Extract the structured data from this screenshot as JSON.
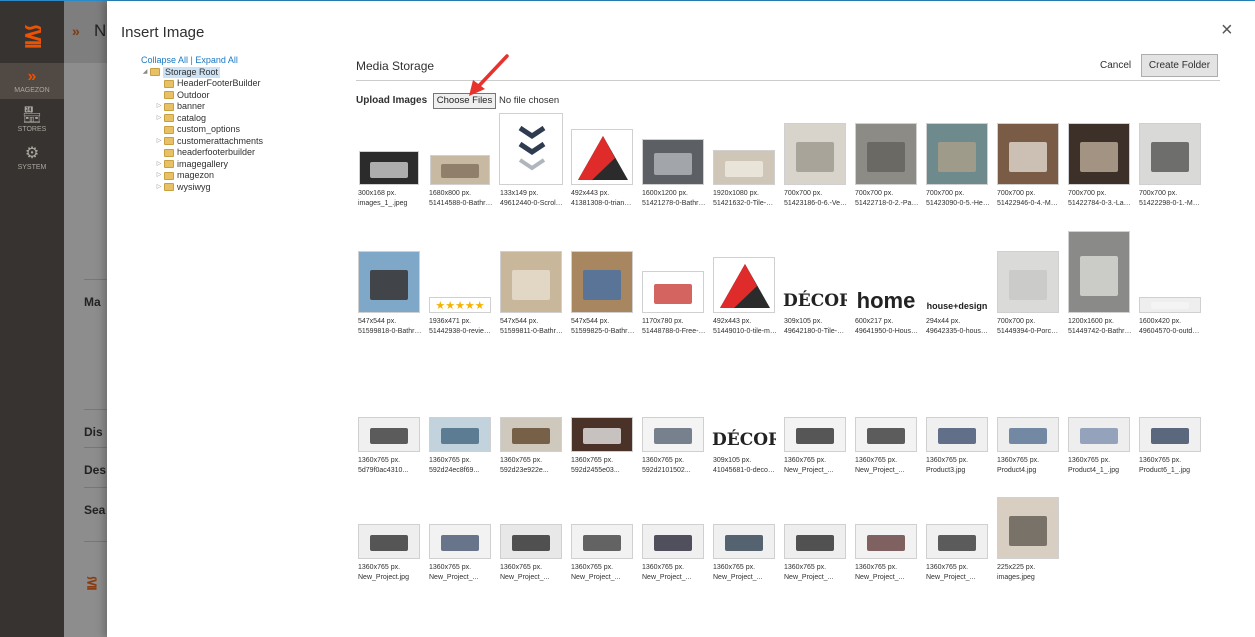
{
  "admin_nav": {
    "items": [
      {
        "label": "MAGEZON",
        "icon": "magezon-icon"
      },
      {
        "label": "STORES",
        "icon": "stores-icon"
      },
      {
        "label": "SYSTEM",
        "icon": "gear-icon"
      }
    ]
  },
  "background": {
    "header_letter": "N",
    "labels": [
      "Ma",
      "Dis",
      "Des",
      "Sea"
    ]
  },
  "modal": {
    "title": "Insert Image",
    "close": "×"
  },
  "tree": {
    "collapse_all": "Collapse All",
    "separator": " | ",
    "expand_all": "Expand All",
    "folders": [
      {
        "name": "Storage Root",
        "expander": "◢",
        "depth": 0,
        "selected": true
      },
      {
        "name": "HeaderFooterBuilder",
        "expander": "",
        "depth": 1
      },
      {
        "name": "Outdoor",
        "expander": "",
        "depth": 1
      },
      {
        "name": "banner",
        "expander": "▷",
        "depth": 1
      },
      {
        "name": "catalog",
        "expander": "▷",
        "depth": 1
      },
      {
        "name": "custom_options",
        "expander": "",
        "depth": 1
      },
      {
        "name": "customerattachments",
        "expander": "▷",
        "depth": 1
      },
      {
        "name": "headerfooterbuilder",
        "expander": "",
        "depth": 1
      },
      {
        "name": "imagegallery",
        "expander": "▷",
        "depth": 1
      },
      {
        "name": "magezon",
        "expander": "▷",
        "depth": 1
      },
      {
        "name": "wysiwyg",
        "expander": "▷",
        "depth": 1
      }
    ]
  },
  "media": {
    "title": "Media Storage",
    "cancel": "Cancel",
    "create_folder": "Create Folder",
    "upload_label": "Upload Images",
    "choose_files": "Choose Files",
    "no_file": "No file chosen"
  },
  "thumbnails": [
    {
      "size": "300x168 px.",
      "name": "images_1_.jpeg",
      "w": 60,
      "h": 34,
      "bg": "#2b2b2b",
      "fg": "#d9d9d9"
    },
    {
      "size": "1680x800 px.",
      "name": "51414588-0-Bathroom-...",
      "w": 60,
      "h": 30,
      "bg": "#c8b9a3",
      "fg": "#7d6c58"
    },
    {
      "size": "133x149 px.",
      "name": "49612440-0-Scroll-do...",
      "w": 64,
      "h": 72,
      "bg": "#ffffff",
      "fg": "#2f3c4f",
      "chev": true
    },
    {
      "size": "492x443 px.",
      "name": "41381308-0-triangle...",
      "w": 62,
      "h": 56,
      "bg": "#ffffff",
      "tri": true
    },
    {
      "size": "1600x1200 px.",
      "name": "51421278-0-Bathroom-...",
      "w": 62,
      "h": 46,
      "bg": "#5c5f63",
      "fg": "#b9bcc0"
    },
    {
      "size": "1920x1080 px.",
      "name": "51421632-0-Tile-Merc...",
      "w": 62,
      "h": 35,
      "bg": "#cfc6b8",
      "fg": "#f2ede5"
    },
    {
      "size": "700x700 px.",
      "name": "51423186-0-6.-Veined...",
      "w": 62,
      "h": 62,
      "bg": "#d8d4cc",
      "fg": "#9a948a"
    },
    {
      "size": "700x700 px.",
      "name": "51422718-0-2.-Patter...",
      "w": 62,
      "h": 62,
      "bg": "#8d8b86",
      "fg": "#5f5d58"
    },
    {
      "size": "700x700 px.",
      "name": "51423090-0-5.-Hexago...",
      "w": 62,
      "h": 62,
      "bg": "#6e8a8c",
      "fg": "#b0a08a"
    },
    {
      "size": "700x700 px.",
      "name": "51422946-0-4.-Mosaic...",
      "w": 62,
      "h": 62,
      "bg": "#7a5b45",
      "fg": "#e8e2da"
    },
    {
      "size": "700x700 px.",
      "name": "51422784-0-3.-Large-...",
      "w": 62,
      "h": 62,
      "bg": "#3c3029",
      "fg": "#c4b4a0"
    },
    {
      "size": "700x700 px.",
      "name": "51422298-0-1.-Metro-...",
      "w": 62,
      "h": 62,
      "bg": "#d9d9d7",
      "fg": "#4a4a48"
    },
    {
      "size": "547x544 px.",
      "name": "51599818-0-Bathroom-...",
      "w": 62,
      "h": 62,
      "bg": "#7fa8c8",
      "fg": "#2c2420"
    },
    {
      "size": "1936x471 px.",
      "name": "51442938-0-reviews-T...",
      "w": 62,
      "h": 16,
      "bg": "#ffffff",
      "stars": true
    },
    {
      "size": "547x544 px.",
      "name": "51599811-0-Bathroom-...",
      "w": 62,
      "h": 62,
      "bg": "#c9b79c",
      "fg": "#e9e0d1"
    },
    {
      "size": "547x544 px.",
      "name": "51599825-0-Bathroom-...",
      "w": 62,
      "h": 62,
      "bg": "#a8865f",
      "fg": "#3f6ea8"
    },
    {
      "size": "1170x780 px.",
      "name": "51448788-0-Free-samp...",
      "w": 62,
      "h": 42,
      "bg": "#ffffff",
      "fg": "#c4302b"
    },
    {
      "size": "492x443 px.",
      "name": "51449010-0-tile-merc...",
      "w": 62,
      "h": 56,
      "bg": "#ffffff",
      "tri": true
    },
    {
      "size": "309x105 px.",
      "name": "49642180-0-Tile-Merc...",
      "w": 64,
      "h": 24,
      "bg": "#ffffff",
      "text": "DÉCOR",
      "tsize": 17,
      "tfont": "serif"
    },
    {
      "size": "600x217 px.",
      "name": "49641950-0-House-and...",
      "w": 64,
      "h": 24,
      "bg": "#ffffff",
      "text": "home",
      "tsize": 22,
      "tfont": "sans"
    },
    {
      "size": "294x44 px.",
      "name": "49642335-0-house-des...",
      "w": 64,
      "h": 14,
      "bg": "#ffffff",
      "text": "house+design",
      "tsize": 9,
      "tfont": "sans"
    },
    {
      "size": "700x700 px.",
      "name": "51449394-0-Porcelain...",
      "w": 62,
      "h": 62,
      "bg": "#dadad8",
      "fg": "#c6c6c4"
    },
    {
      "size": "1200x1600 px.",
      "name": "51449742-0-Bathroom-...",
      "w": 62,
      "h": 82,
      "bg": "#8a8a88",
      "fg": "#e0e0de"
    },
    {
      "size": "1600x420 px.",
      "name": "49604570-0-outdoor-t...",
      "w": 62,
      "h": 16,
      "bg": "#eeeeee",
      "fg": "#f6f6f6"
    },
    {
      "size": "1360x765 px.",
      "name": "5d79f0ac4310...",
      "w": 62,
      "h": 35,
      "bg": "#f0f0f0",
      "fg": "#2a2a2a"
    },
    {
      "size": "1360x765 px.",
      "name": "592d24ec8f69...",
      "w": 62,
      "h": 35,
      "bg": "#c2d3de",
      "fg": "#3a5f7a"
    },
    {
      "size": "1360x765 px.",
      "name": "592d23e922e...",
      "w": 62,
      "h": 35,
      "bg": "#cfc8bc",
      "fg": "#5a3e22"
    },
    {
      "size": "1360x765 px.",
      "name": "592d2455e03...",
      "w": 62,
      "h": 35,
      "bg": "#4a3228",
      "fg": "#f2f2f2"
    },
    {
      "size": "1360x765 px.",
      "name": "592d2101502...",
      "w": 62,
      "h": 35,
      "bg": "#f4f4f4",
      "fg": "#4d5b6b"
    },
    {
      "size": "309x105 px.",
      "name": "41045681-0-decor-web...",
      "w": 64,
      "h": 24,
      "bg": "#ffffff",
      "text": "DÉCOR",
      "tsize": 17,
      "tfont": "serif"
    },
    {
      "size": "1360x765 px.",
      "name": "New_Project_...",
      "w": 62,
      "h": 35,
      "bg": "#f3f3f3",
      "fg": "#222222"
    },
    {
      "size": "1360x765 px.",
      "name": "New_Project_...",
      "w": 62,
      "h": 35,
      "bg": "#f3f3f3",
      "fg": "#2a2a2a"
    },
    {
      "size": "1360x765 px.",
      "name": "Product3.jpg",
      "w": 62,
      "h": 35,
      "bg": "#f0f0f0",
      "fg": "#334466"
    },
    {
      "size": "1360x765 px.",
      "name": "Product4.jpg",
      "w": 62,
      "h": 35,
      "bg": "#eeeeee",
      "fg": "#4a6688"
    },
    {
      "size": "1360x765 px.",
      "name": "Product4_1_.jpg",
      "w": 62,
      "h": 35,
      "bg": "#eeeeee",
      "fg": "#7788aa"
    },
    {
      "size": "1360x765 px.",
      "name": "Product6_1_.jpg",
      "w": 62,
      "h": 35,
      "bg": "#f0f0f0",
      "fg": "#2a3a55"
    },
    {
      "size": "1360x765 px.",
      "name": "New_Project.jpg",
      "w": 62,
      "h": 35,
      "bg": "#eeeeee",
      "fg": "#222222"
    },
    {
      "size": "1360x765 px.",
      "name": "New_Project_...",
      "w": 62,
      "h": 35,
      "bg": "#f2f2f2",
      "fg": "#3a4a66"
    },
    {
      "size": "1360x765 px.",
      "name": "New_Project_...",
      "w": 62,
      "h": 35,
      "bg": "#e8e8e8",
      "fg": "#1e1e1e"
    },
    {
      "size": "1360x765 px.",
      "name": "New_Project_...",
      "w": 62,
      "h": 35,
      "bg": "#f2f2f2",
      "fg": "#333333"
    },
    {
      "size": "1360x765 px.",
      "name": "New_Project_...",
      "w": 62,
      "h": 35,
      "bg": "#f0f0f0",
      "fg": "#1a1a2e"
    },
    {
      "size": "1360x765 px.",
      "name": "New_Project_...",
      "w": 62,
      "h": 35,
      "bg": "#f0f0f0",
      "fg": "#223344"
    },
    {
      "size": "1360x765 px.",
      "name": "New_Project_...",
      "w": 62,
      "h": 35,
      "bg": "#eeeeee",
      "fg": "#1c1c1c"
    },
    {
      "size": "1360x765 px.",
      "name": "New_Project_...",
      "w": 62,
      "h": 35,
      "bg": "#f2f2f2",
      "fg": "#5a3030"
    },
    {
      "size": "1360x765 px.",
      "name": "New_Project_...",
      "w": 62,
      "h": 35,
      "bg": "#f0f0f0",
      "fg": "#2a2a2a"
    },
    {
      "size": "225x225 px.",
      "name": "images.jpeg",
      "w": 62,
      "h": 62,
      "bg": "#d8cfc2",
      "fg": "#5a534a"
    }
  ]
}
